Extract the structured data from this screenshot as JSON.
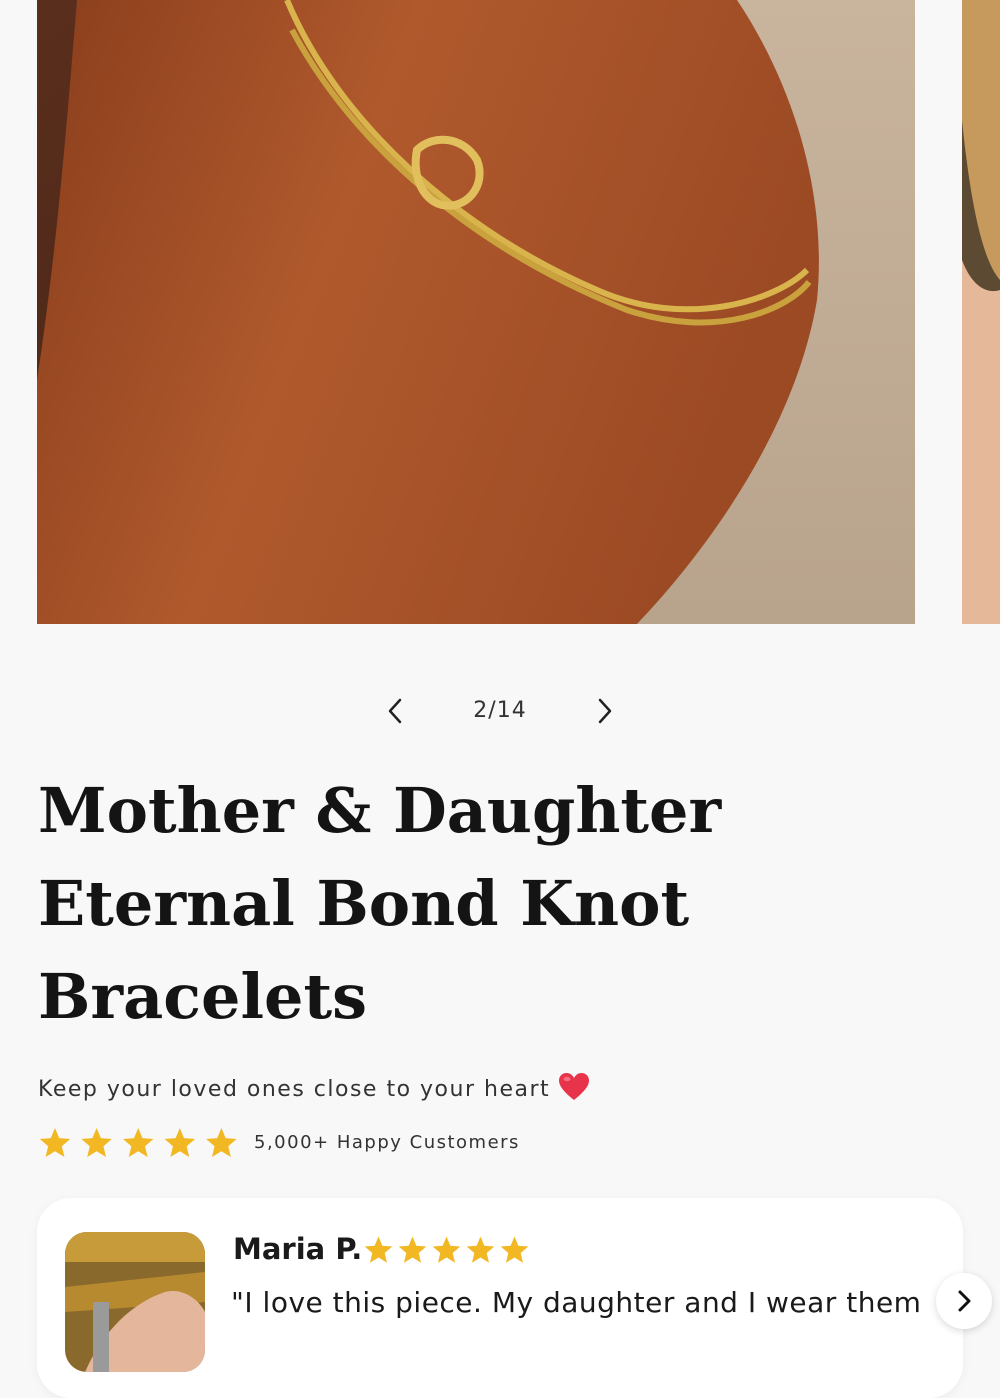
{
  "gallery": {
    "current_image": "gold knot bracelet on arm",
    "counter": "2/14",
    "prev_icon": "chevron-left-icon",
    "next_icon": "chevron-right-icon"
  },
  "product": {
    "title": "Mother & Daughter Eternal Bond Knot Bracelets",
    "tagline": "Keep your loved ones close to your heart",
    "tagline_icon": "heart-icon",
    "rating": 5,
    "rating_max": 5,
    "customers_label": "5,000+ Happy Customers"
  },
  "review": {
    "name": "Maria P.",
    "rating": 5,
    "quote": "\"I love this piece. My daughter and I wear them",
    "next_icon": "chevron-right-icon"
  },
  "colors": {
    "star": "#f2b824",
    "background": "#f8f8f8",
    "card": "#ffffff",
    "heart": "#e8344a"
  }
}
